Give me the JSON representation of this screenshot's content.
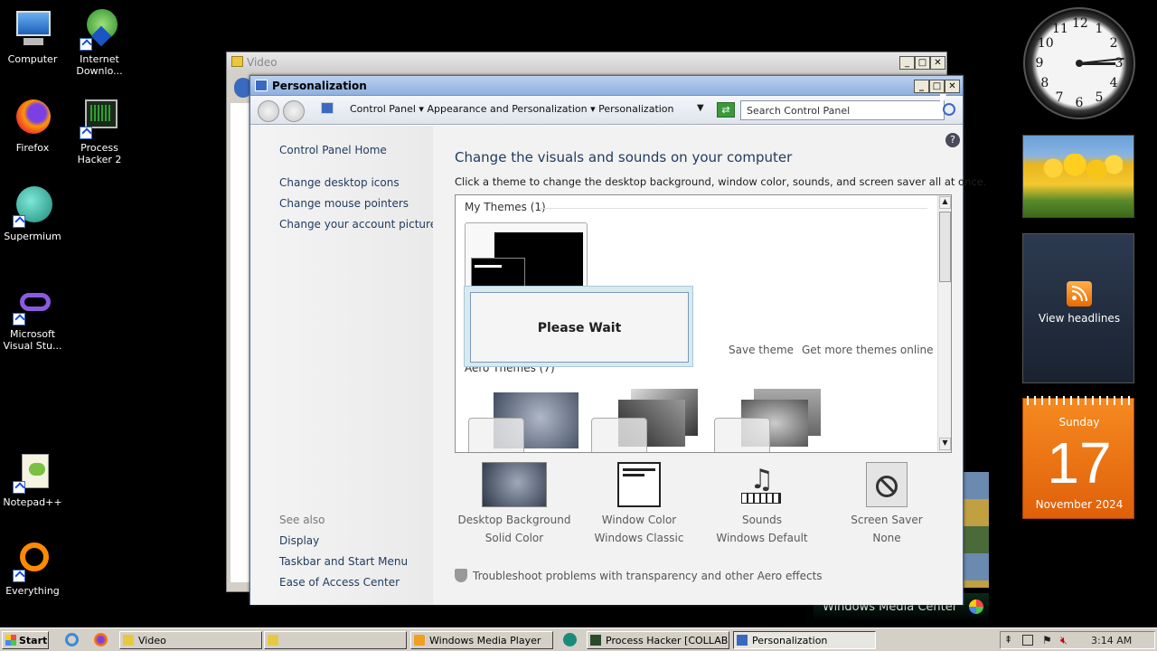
{
  "desktop": {
    "icons": [
      {
        "label": "Computer"
      },
      {
        "label": "Internet Downlo..."
      },
      {
        "label": "Firefox"
      },
      {
        "label": "Process Hacker 2"
      },
      {
        "label": "Supermium"
      },
      {
        "label": "Microsoft Visual Stu..."
      },
      {
        "label": "Notepad++"
      },
      {
        "label": "Everything"
      }
    ]
  },
  "video_window": {
    "title": "Video"
  },
  "personalization": {
    "title": "Personalization",
    "breadcrumb": [
      "Control Panel",
      "Appearance and Personalization",
      "Personalization"
    ],
    "search_placeholder": "Search Control Panel",
    "left_links": [
      "Control Panel Home",
      "Change desktop icons",
      "Change mouse pointers",
      "Change your account picture"
    ],
    "see_also_label": "See also",
    "see_also_links": [
      "Display",
      "Taskbar and Start Menu",
      "Ease of Access Center"
    ],
    "heading": "Change the visuals and sounds on your computer",
    "subheading": "Click a theme to change the desktop background, window color, sounds, and screen saver all at once.",
    "my_themes_label": "My Themes (1)",
    "aero_themes_label": "Aero Themes (7)",
    "save_theme": "Save theme",
    "get_more": "Get more themes online",
    "please_wait": "Please Wait",
    "bottom_items": [
      {
        "title": "Desktop Background",
        "value": "Solid Color"
      },
      {
        "title": "Window Color",
        "value": "Windows Classic"
      },
      {
        "title": "Sounds",
        "value": "Windows Default"
      },
      {
        "title": "Screen Saver",
        "value": "None"
      }
    ],
    "troubleshoot": "Troubleshoot problems with transparency and other Aero effects"
  },
  "gadgets": {
    "feed": "View headlines",
    "calendar": {
      "weekday": "Sunday",
      "day": "17",
      "month_year": "November 2024"
    },
    "clock_numbers": [
      "12",
      "1",
      "2",
      "3",
      "4",
      "5",
      "6",
      "7",
      "8",
      "9",
      "10",
      "11"
    ]
  },
  "media_center_label": "Windows Media Center",
  "taskbar": {
    "start": "Start",
    "tasks": [
      {
        "label": "Video"
      },
      {
        "label": ""
      },
      {
        "label": "Windows Media Player"
      },
      {
        "label": "Process Hacker [COLLAB..."
      },
      {
        "label": "Personalization"
      }
    ],
    "time": "3:14 AM"
  },
  "colors": {
    "accent": "#e8590c",
    "title_blue": "#8fb0e0",
    "taskbar": "#d4d0c8"
  }
}
